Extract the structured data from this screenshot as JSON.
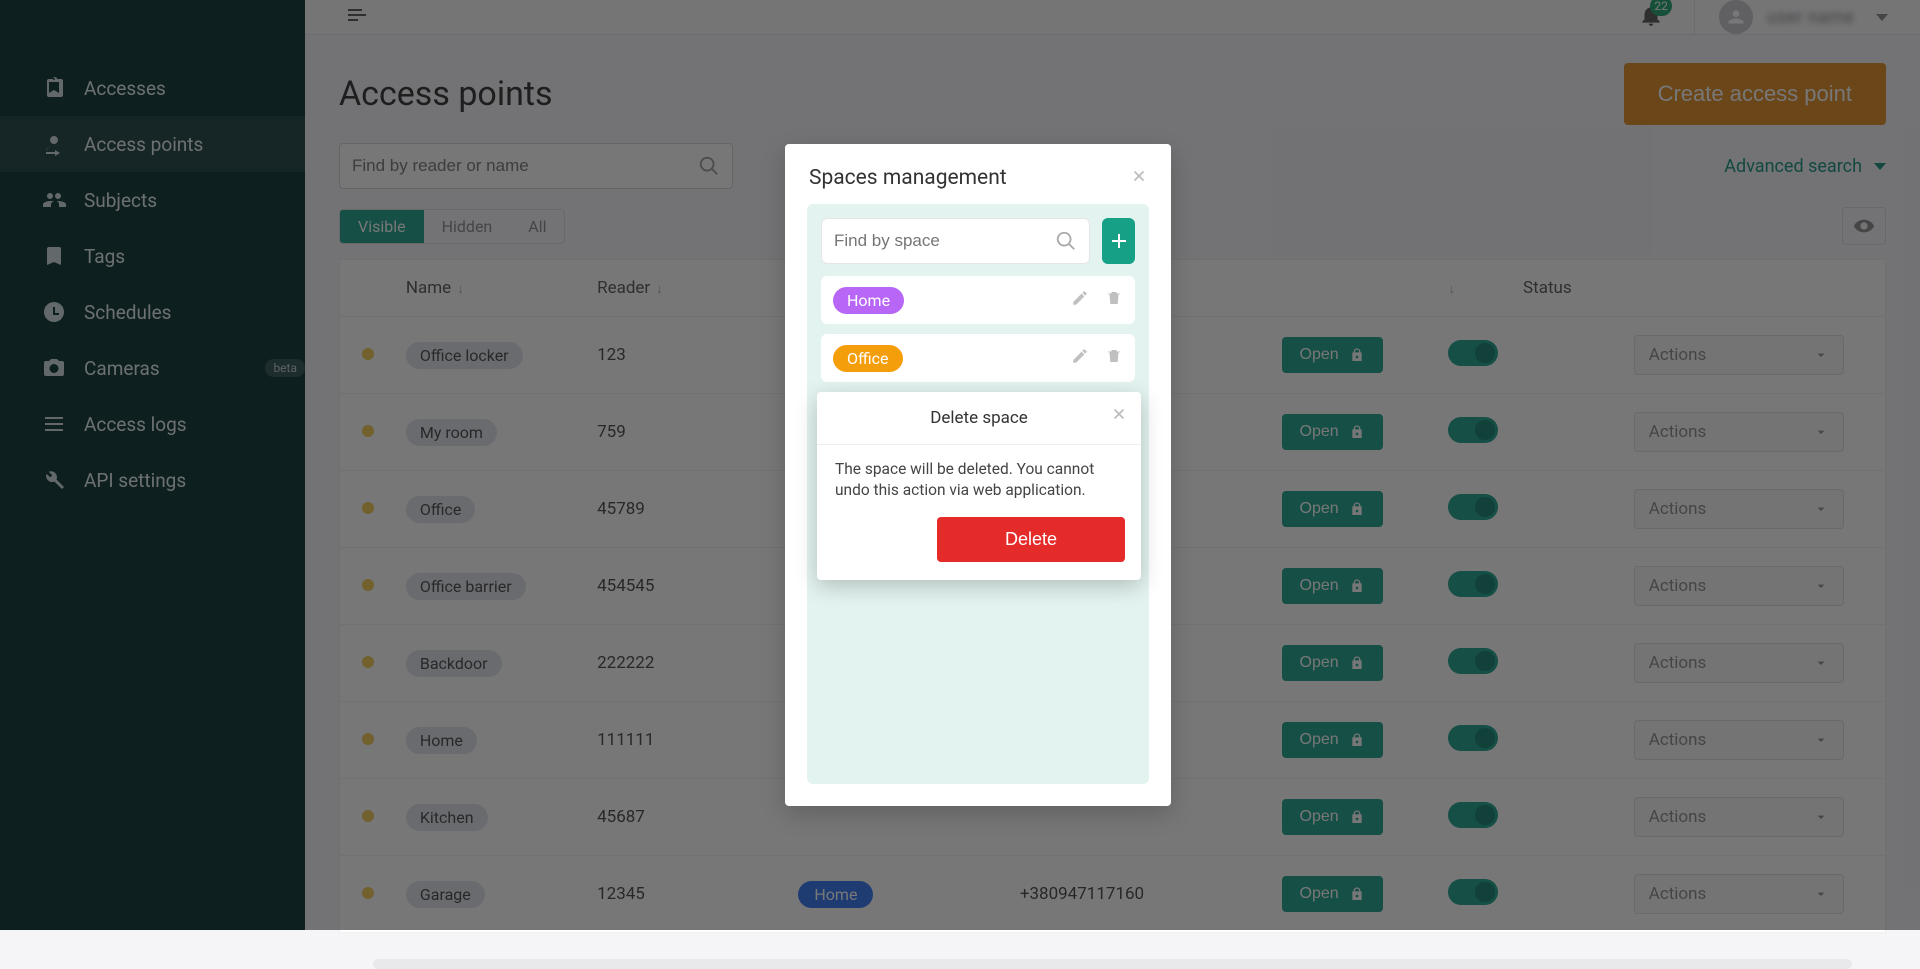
{
  "header": {
    "notification_count": "22",
    "username": "user name"
  },
  "sidebar": {
    "items": [
      {
        "label": "Accesses",
        "icon": "clipboard-icon"
      },
      {
        "label": "Access points",
        "icon": "entrance-icon"
      },
      {
        "label": "Subjects",
        "icon": "people-icon"
      },
      {
        "label": "Tags",
        "icon": "tag-icon"
      },
      {
        "label": "Schedules",
        "icon": "clock-icon"
      },
      {
        "label": "Cameras",
        "icon": "camera-icon",
        "badge": "beta"
      },
      {
        "label": "Access logs",
        "icon": "list-icon"
      },
      {
        "label": "API settings",
        "icon": "wrench-icon"
      }
    ]
  },
  "page": {
    "title": "Access points",
    "create_button": "Create access point",
    "search_placeholder": "Find by reader or name",
    "advanced_search_label": "Advanced search"
  },
  "filters": {
    "visible": "Visible",
    "hidden": "Hidden",
    "all": "All"
  },
  "table": {
    "columns": {
      "name": "Name",
      "reader": "Reader",
      "status": "Status",
      "actions_placeholder": "Actions",
      "open_label": "Open"
    },
    "rows": [
      {
        "name": "Office locker",
        "reader": "123",
        "space": "",
        "ip": ""
      },
      {
        "name": "My room",
        "reader": "759",
        "space": "",
        "ip": ""
      },
      {
        "name": "Office",
        "reader": "45789",
        "space": "",
        "ip": ""
      },
      {
        "name": "Office barrier",
        "reader": "454545",
        "space": "",
        "ip": ""
      },
      {
        "name": "Backdoor",
        "reader": "222222",
        "space": "",
        "ip": ""
      },
      {
        "name": "Home",
        "reader": "111111",
        "space": "",
        "ip": ""
      },
      {
        "name": "Kitchen",
        "reader": "45687",
        "space": "",
        "ip": ""
      },
      {
        "name": "Garage",
        "reader": "12345",
        "space": "Home",
        "ip": "+380947117160"
      }
    ]
  },
  "spaces_modal": {
    "title": "Spaces management",
    "search_placeholder": "Find by space",
    "items": [
      {
        "label": "Home",
        "color_class": "chip-home"
      },
      {
        "label": "Office",
        "color_class": "chip-office"
      }
    ]
  },
  "confirm": {
    "title": "Delete space",
    "body": "The space will be deleted. You cannot undo this action via web application.",
    "delete_button": "Delete"
  }
}
